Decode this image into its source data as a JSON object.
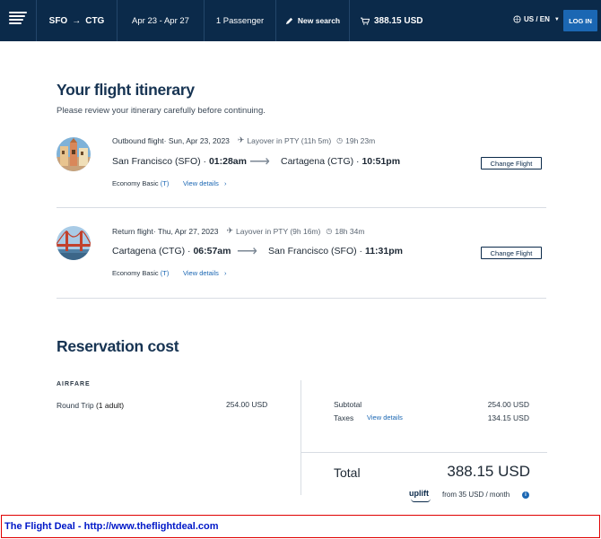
{
  "header": {
    "origin": "SFO",
    "arrow": "→",
    "destination": "CTG",
    "dates": "Apr 23 - Apr 27",
    "passengers": "1 Passenger",
    "new_search": "New search",
    "cart_total": "388.15 USD",
    "locale": "US / EN",
    "login": "LOG IN"
  },
  "itinerary": {
    "title": "Your flight itinerary",
    "subtitle": "Please review your itinerary carefully before continuing.",
    "flights": [
      {
        "label": "Outbound flight",
        "date": " · Sun, Apr 23, 2023",
        "layover": "Layover in PTY (11h 5m)",
        "duration": "19h 23m",
        "from_city": "San Francisco (SFO) · ",
        "from_time": "01:28am",
        "to_city": "Cartagena (CTG) · ",
        "to_time": "10:51pm",
        "fare": "Economy Basic ",
        "fare_code": "(T)",
        "view_details": "View details",
        "change": "Change Flight"
      },
      {
        "label": "Return flight",
        "date": " · Thu, Apr 27, 2023",
        "layover": "Layover in PTY (9h 16m)",
        "duration": "18h 34m",
        "from_city": "Cartagena (CTG) · ",
        "from_time": "06:57am",
        "to_city": "San Francisco (SFO) · ",
        "to_time": "11:31pm",
        "fare": "Economy Basic ",
        "fare_code": "(T)",
        "view_details": "View details",
        "change": "Change Flight"
      }
    ]
  },
  "reservation": {
    "title": "Reservation cost",
    "airfare_heading": "AIRFARE",
    "round_trip": "Round Trip ",
    "round_trip_qty": "(1 adult)",
    "round_trip_price": "254.00 USD",
    "subtotal_label": "Subtotal",
    "subtotal_value": "254.00 USD",
    "taxes_label": "Taxes",
    "taxes_details": "View details",
    "taxes_value": "134.15 USD",
    "total_label": "Total",
    "total_value": "388.15 USD",
    "uplift_brand": "uplift",
    "monthly": "from 35 USD  / month"
  },
  "footer": {
    "text": "The Flight Deal - http://www.theflightdeal.com"
  },
  "colors": {
    "header_bg": "#0b2a4a",
    "accent": "#1b67b3",
    "footer_border": "#e00000",
    "footer_text": "#0018c8"
  }
}
